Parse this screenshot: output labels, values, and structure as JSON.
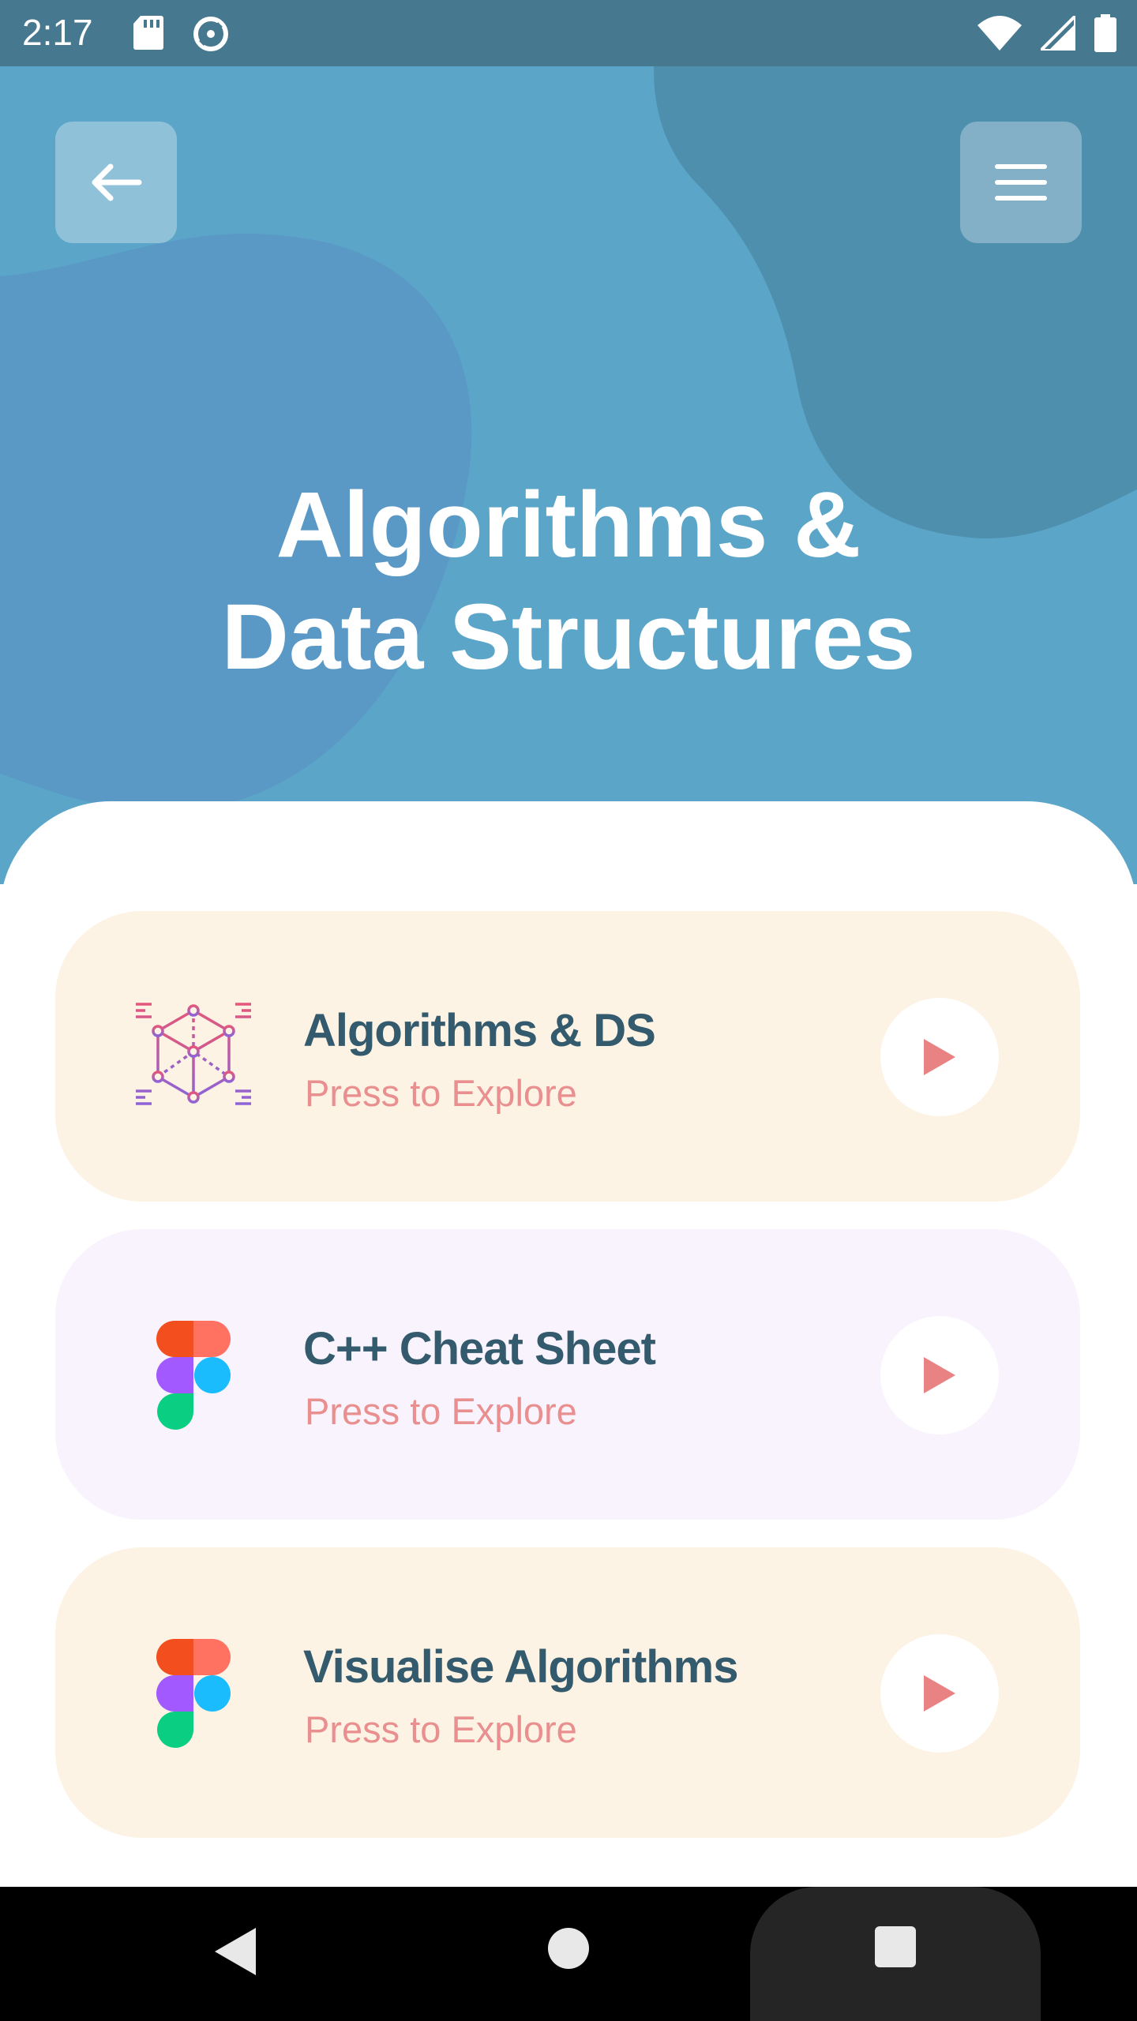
{
  "status_bar": {
    "time": "2:17",
    "left_icons": [
      "sd-card-icon",
      "data-saver-icon"
    ],
    "right_icons": [
      "wifi-icon",
      "cell-signal-icon",
      "battery-icon"
    ]
  },
  "header": {
    "back_icon": "arrow-left-icon",
    "menu_icon": "hamburger-menu-icon",
    "title_line1": "Algorithms &",
    "title_line2": "Data Structures"
  },
  "cards": [
    {
      "title": "Algorithms & DS",
      "subtitle": "Press to Explore",
      "icon": "cube-network-icon",
      "background": "#fdf3e4"
    },
    {
      "title": "C++ Cheat Sheet",
      "subtitle": "Press to Explore",
      "icon": "figma-logo-icon",
      "background": "#f9f3fd"
    },
    {
      "title": "Visualise Algorithms",
      "subtitle": "Press to Explore",
      "icon": "figma-logo-icon",
      "background": "#fdf3e4"
    }
  ],
  "colors": {
    "hero_background": "#5ba5c8",
    "status_bar": "#46788f",
    "title_text": "#345a6d",
    "subtitle_text": "#e98f8f",
    "play_icon": "#e98383"
  },
  "nav_bar": {
    "back_icon": "triangle-back-icon",
    "home_icon": "circle-home-icon",
    "recents_icon": "square-recents-icon"
  }
}
